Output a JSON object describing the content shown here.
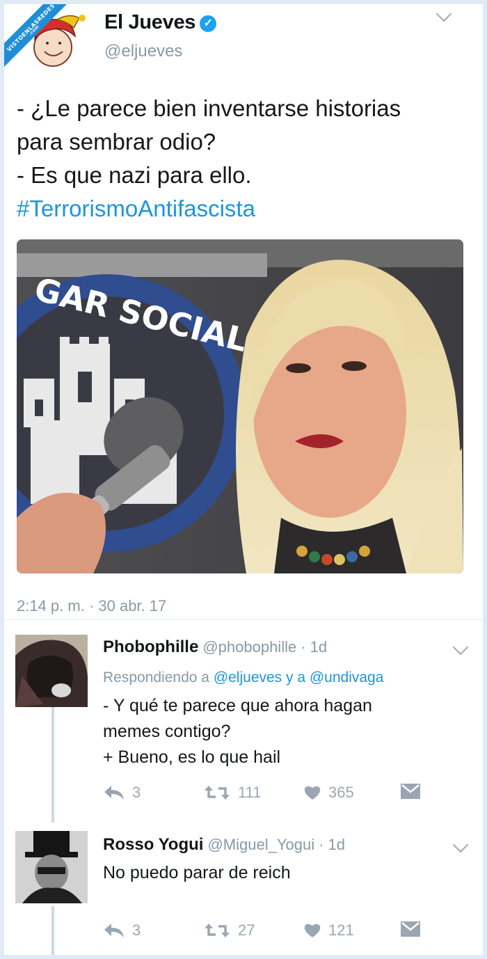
{
  "watermark": {
    "text": "VISTOENLASREDES",
    "sub": ".com"
  },
  "tweet": {
    "author_name": "El Jueves",
    "handle": "@eljueves",
    "text_lines": [
      "- ¿Le parece bien inventarse historias",
      "para sembrar odio?",
      "- Es que nazi para ello."
    ],
    "hashtag": "#TerrorismoAntifascista",
    "media_banner": "GAR SOCIAL",
    "timestamp": "2:14 p. m. · 30 abr. 17"
  },
  "replies": [
    {
      "name": "Phobophille",
      "handle": "@phobophille",
      "time": "· 1d",
      "replying_prefix": "Respondiendo a",
      "replying_to": "@eljueves y a @undivaga",
      "lines": [
        "- Y qué te parece que ahora hagan",
        "memes contigo?",
        "+ Bueno, es lo que hail"
      ],
      "reply_count": "3",
      "retweet_count": "111",
      "like_count": "365"
    },
    {
      "name": "Rosso Yogui",
      "handle": "@Miguel_Yogui",
      "time": "· 1d",
      "lines": [
        "No puedo parar de reich"
      ],
      "reply_count": "3",
      "retweet_count": "27",
      "like_count": "121"
    }
  ],
  "colors": {
    "link": "#1b95e0",
    "muted": "#8899a6",
    "text": "#14171a",
    "verified": "#1da1f2",
    "border": "#e1ebf5"
  },
  "icons": [
    "verified-badge-icon",
    "chevron-down-icon",
    "reply-icon",
    "retweet-icon",
    "heart-icon",
    "direct-message-icon"
  ]
}
